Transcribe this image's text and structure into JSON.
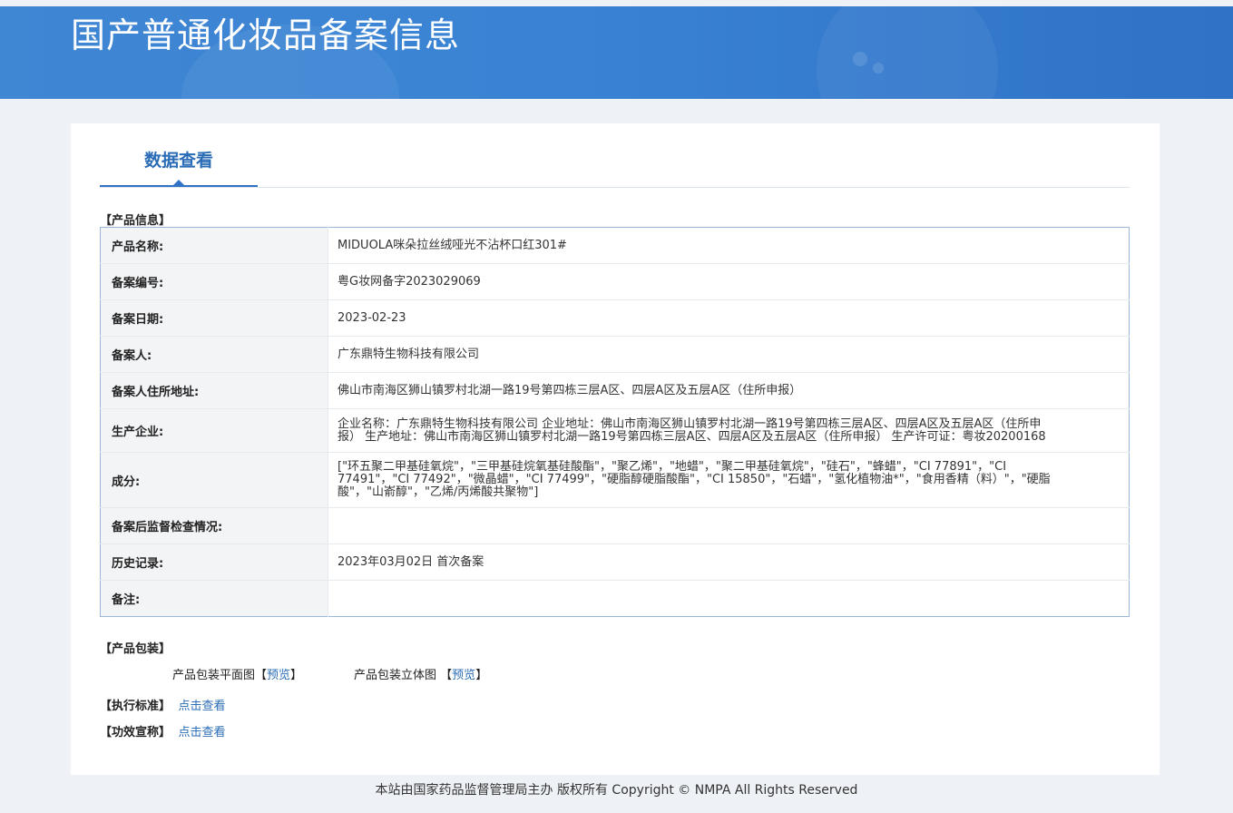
{
  "header": {
    "title": "国产普通化妆品备案信息"
  },
  "tabs": {
    "active": "数据查看"
  },
  "product_info": {
    "section_label": "【产品信息】",
    "rows": [
      {
        "key": "产品名称:",
        "value": "MIDUOLA咪朵拉丝绒哑光不沾杯口红301#"
      },
      {
        "key": "备案编号:",
        "value": "粤G妆网备字2023029069"
      },
      {
        "key": "备案日期:",
        "value": "2023-02-23"
      },
      {
        "key": "备案人:",
        "value": "广东鼎特生物科技有限公司"
      },
      {
        "key": "备案人住所地址:",
        "value": "佛山市南海区狮山镇罗村北湖一路19号第四栋三层A区、四层A区及五层A区（住所申报）"
      },
      {
        "key": "生产企业:",
        "value": "企业名称：广东鼎特生物科技有限公司 企业地址：佛山市南海区狮山镇罗村北湖一路19号第四栋三层A区、四层A区及五层A区（住所申报） 生产地址：佛山市南海区狮山镇罗村北湖一路19号第四栋三层A区、四层A区及五层A区（住所申报） 生产许可证：粤妆20200168"
      },
      {
        "key": "成分:",
        "value": "[\"环五聚二甲基硅氧烷\"，\"三甲基硅烷氧基硅酸酯\"，\"聚乙烯\"，\"地蜡\"，\"聚二甲基硅氧烷\"，\"硅石\"，\"蜂蜡\"，\"CI 77891\"，\"CI 77491\"，\"CI 77492\"，\"微晶蜡\"，\"CI 77499\"，\"硬脂醇硬脂酸酯\"，\"CI 15850\"，\"石蜡\"，\"氢化植物油*\"，\"食用香精（料）\"，\"硬脂酸\"，\"山嵛醇\"，\"乙烯/丙烯酸共聚物\"]"
      },
      {
        "key": "备案后监督检查情况:",
        "value": ""
      },
      {
        "key": "历史记录:",
        "value": "2023年03月02日 首次备案"
      },
      {
        "key": "备注:",
        "value": ""
      }
    ]
  },
  "packaging": {
    "section_label": "【产品包装】",
    "flat_label": "产品包装平面图",
    "flat_bracket_open": "【",
    "flat_link": "预览",
    "flat_bracket_close": "】",
    "three_d_label": "产品包装立体图",
    "three_d_bracket_open": "【",
    "three_d_link": "预览",
    "three_d_bracket_close": "】"
  },
  "standard": {
    "label": "【执行标准】",
    "link": "点击查看"
  },
  "efficacy": {
    "label": "【功效宣称】",
    "link": "点击查看"
  },
  "footer": {
    "text": "本站由国家药品监督管理局主办 版权所有 Copyright © NMPA All Rights Reserved"
  }
}
